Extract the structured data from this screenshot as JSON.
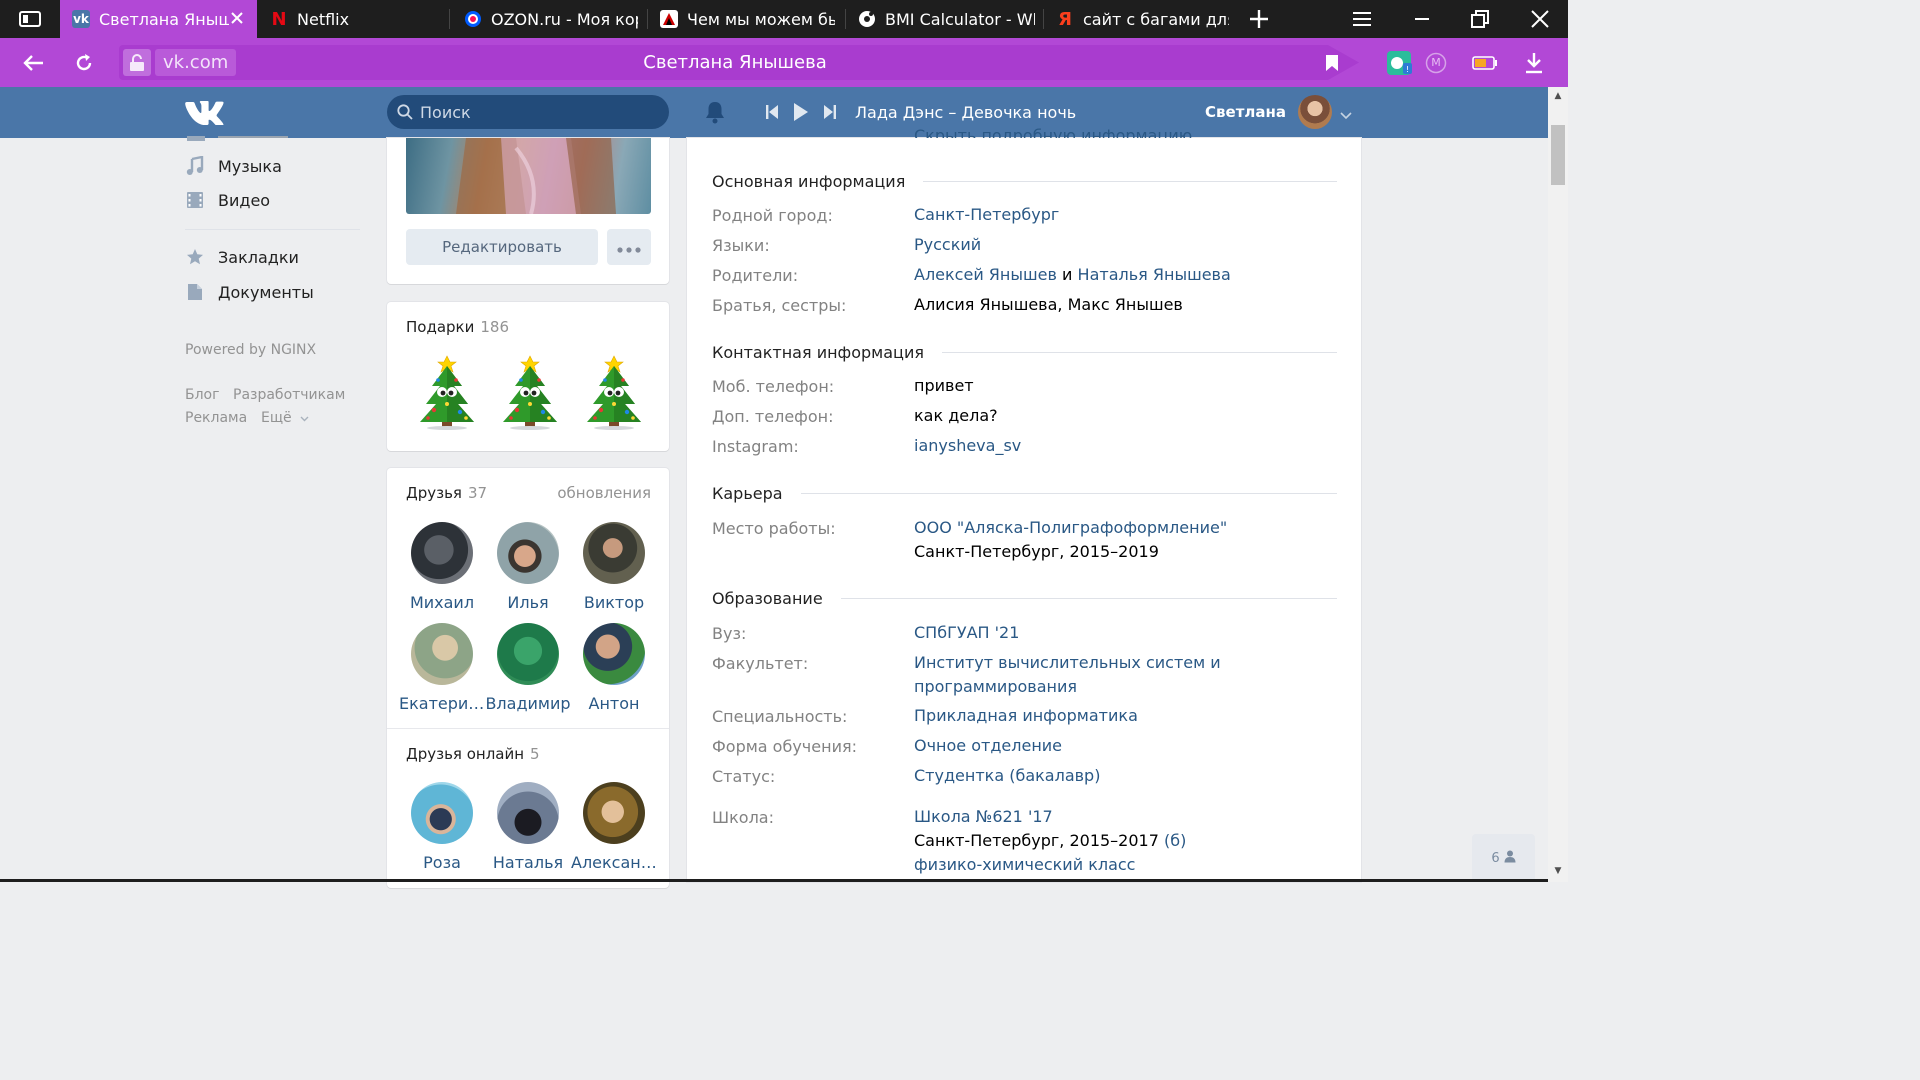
{
  "browser": {
    "tabs": [
      {
        "label": "Светлана Янышева",
        "favicon": "vk-icon",
        "active": true
      },
      {
        "label": "Netflix",
        "favicon": "netflix-icon"
      },
      {
        "label": "OZON.ru - Моя корзина",
        "favicon": "ozon-icon"
      },
      {
        "label": "Чем мы можем быть полезны",
        "favicon": "site-icon"
      },
      {
        "label": "BMI Calculator - What is",
        "favicon": "bmi-icon"
      },
      {
        "label": "сайт с багами для тестирования",
        "favicon": "yandex-icon"
      }
    ],
    "address": {
      "domain": "vk.com",
      "page_title": "Светлана Янышева",
      "profile_badge": "M"
    },
    "accent": "#b248d6"
  },
  "vk": {
    "search_placeholder": "Поиск",
    "now_playing": "Лада Дэнс – Девочка ночь",
    "user_name": "Светлана",
    "header_color": "#4a76a8",
    "link_color": "#2a5885"
  },
  "left_menu": {
    "items": [
      {
        "label": "Музыка",
        "icon": "music-icon"
      },
      {
        "label": "Видео",
        "icon": "video-icon"
      },
      {
        "label": "Закладки",
        "icon": "star-icon"
      },
      {
        "label": "Документы",
        "icon": "document-icon"
      }
    ],
    "powered_by": "Powered by NGINX",
    "footer_links": [
      "Блог",
      "Разработчикам",
      "Реклама",
      "Ещё"
    ]
  },
  "profile": {
    "edit_button": "Редактировать",
    "gifts": {
      "title": "Подарки",
      "count": "186"
    },
    "friends": {
      "title": "Друзья",
      "count": "37",
      "updates_link": "обновления",
      "list": [
        "Михаил",
        "Илья",
        "Виктор",
        "Екатерина",
        "Владимир",
        "Антон"
      ]
    },
    "friends_online": {
      "title": "Друзья онлайн",
      "count": "5",
      "list": [
        "Роза",
        "Наталья",
        "Александра"
      ]
    }
  },
  "info": {
    "top_link": "Скрыть подробную информацию",
    "sections": {
      "basic": "Основная информация",
      "contacts": "Контактная информация",
      "career": "Карьера",
      "education": "Образование"
    },
    "hometown": {
      "label": "Родной город:",
      "value": "Санкт-Петербург"
    },
    "languages": {
      "label": "Языки:",
      "value": "Русский"
    },
    "parents": {
      "label": "Родители:",
      "father": "Алексей Янышев",
      "and": "и",
      "mother": "Наталья Янышева"
    },
    "siblings": {
      "label": "Братья, сестры:",
      "value": "Алисия Янышева, Макс Янышев"
    },
    "mobile": {
      "label": "Моб. телефон:",
      "value": "привет"
    },
    "extra_phone": {
      "label": "Доп. телефон:",
      "value": "как дела?"
    },
    "instagram": {
      "label": "Instagram:",
      "value": "ianysheva_sv"
    },
    "work": {
      "label": "Место работы:",
      "company": "ООО \"Аляска-Полиграфоформление\"",
      "details": "Санкт-Петербург, 2015–2019"
    },
    "university": {
      "label": "Вуз:",
      "value": "СПбГУАП '21"
    },
    "faculty": {
      "label": "Факультет:",
      "line1": "Институт вычислительных систем и",
      "line2": "программирования"
    },
    "specialty": {
      "label": "Специальность:",
      "value": "Прикладная информатика"
    },
    "study_form": {
      "label": "Форма обучения:",
      "value": "Очное отделение"
    },
    "status": {
      "label": "Статус:",
      "value": "Студентка (бакалавр)"
    },
    "school": {
      "label": "Школа:",
      "name": "Школа №621 '17",
      "years": "Санкт-Петербург, 2015–2017",
      "letter": "(б)",
      "class": "физико-химический класс"
    }
  },
  "chat_badge": {
    "count": "6"
  }
}
